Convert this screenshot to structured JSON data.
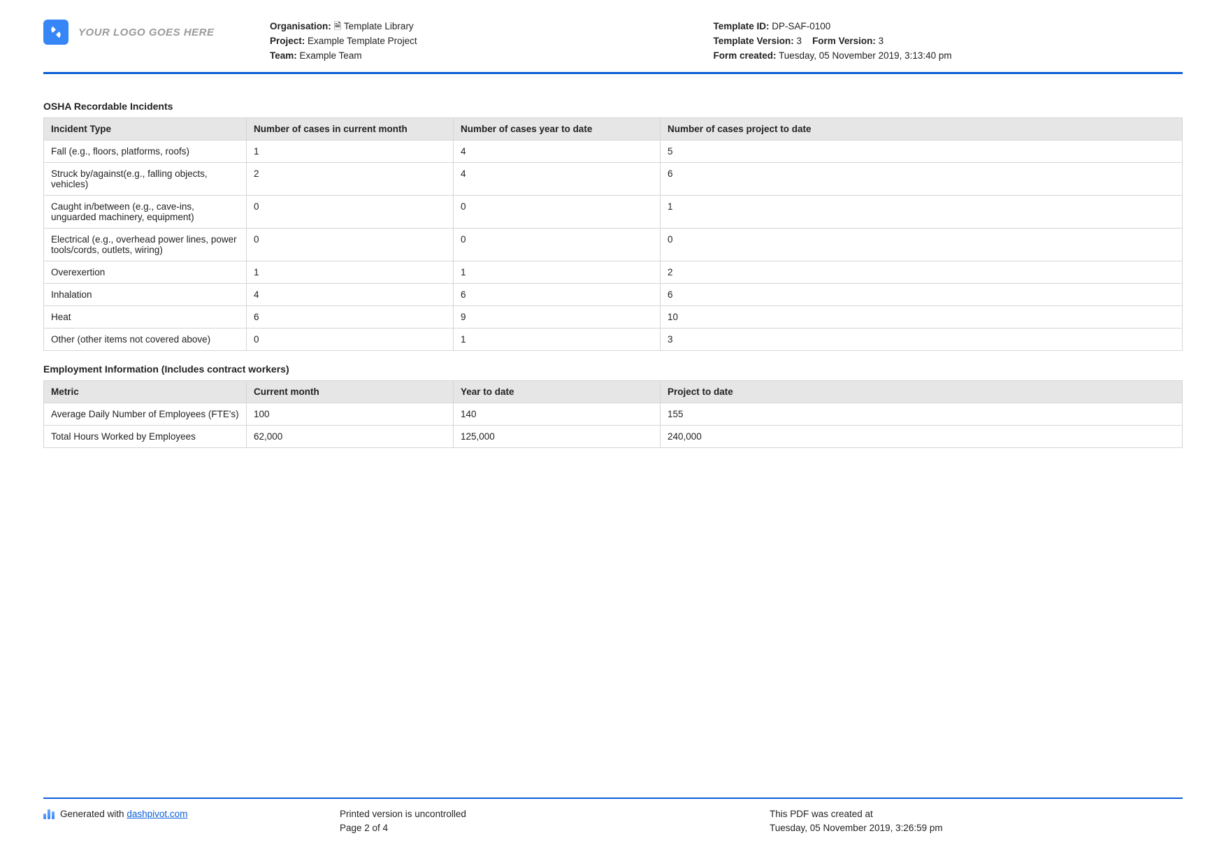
{
  "header": {
    "logo_placeholder": "YOUR LOGO GOES HERE",
    "org_label": "Organisation:",
    "org_value": "🗎 Template Library",
    "project_label": "Project:",
    "project_value": "Example Template Project",
    "team_label": "Team:",
    "team_value": "Example Team",
    "template_id_label": "Template ID:",
    "template_id_value": "DP-SAF-0100",
    "template_version_label": "Template Version:",
    "template_version_value": "3",
    "form_version_label": "Form Version:",
    "form_version_value": "3",
    "form_created_label": "Form created:",
    "form_created_value": "Tuesday, 05 November 2019, 3:13:40 pm"
  },
  "sections": {
    "osha_title": "OSHA Recordable Incidents",
    "osha_headers": [
      "Incident Type",
      "Number of cases in current month",
      "Number of cases year to date",
      "Number of cases project to date"
    ],
    "osha_rows": [
      [
        "Fall (e.g., floors, platforms, roofs)",
        "1",
        "4",
        "5"
      ],
      [
        "Struck by/against(e.g., falling objects, vehicles)",
        "2",
        "4",
        "6"
      ],
      [
        "Caught in/between (e.g., cave-ins, unguarded machinery, equipment)",
        "0",
        "0",
        "1"
      ],
      [
        "Electrical (e.g., overhead power lines, power tools/cords, outlets, wiring)",
        "0",
        "0",
        "0"
      ],
      [
        "Overexertion",
        "1",
        "1",
        "2"
      ],
      [
        "Inhalation",
        "4",
        "6",
        "6"
      ],
      [
        "Heat",
        "6",
        "9",
        "10"
      ],
      [
        "Other (other items not covered above)",
        "0",
        "1",
        "3"
      ]
    ],
    "emp_title": "Employment Information (Includes contract workers)",
    "emp_headers": [
      "Metric",
      "Current month",
      "Year to date",
      "Project to date"
    ],
    "emp_rows": [
      [
        "Average Daily Number of Employees (FTE's)",
        "100",
        "140",
        "155"
      ],
      [
        "Total Hours Worked by Employees",
        "62,000",
        "125,000",
        "240,000"
      ]
    ]
  },
  "footer": {
    "generated_prefix": "Generated with ",
    "generated_link": "dashpivot.com",
    "uncontrolled": "Printed version is uncontrolled",
    "page": "Page 2 of 4",
    "created_at_label": "This PDF was created at",
    "created_at_value": "Tuesday, 05 November 2019, 3:26:59 pm"
  }
}
